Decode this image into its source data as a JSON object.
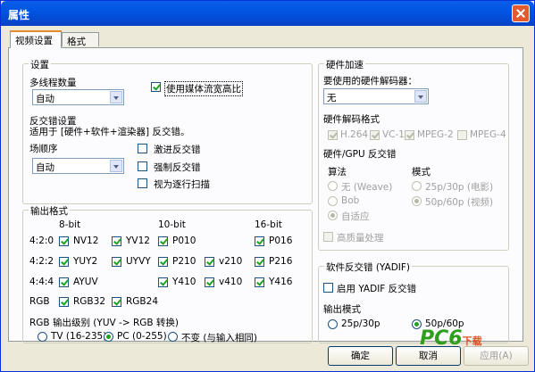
{
  "window": {
    "title": "属性"
  },
  "tabs": [
    "视频设置",
    "格式"
  ],
  "settings": {
    "title": "设置",
    "threads_label": "多线程数量",
    "threads_value": "自动",
    "use_media_ratio": "使用媒体流宽高比",
    "deinterlace_label": "反交错设置",
    "deinterlace_desc": "适用于 [硬件+软件+渲染器] 反交错。",
    "field_order_label": "场顺序",
    "field_order_value": "自动",
    "aggressive": "激进反交错",
    "force": "强制反交错",
    "progressive": "视为逐行扫描"
  },
  "output": {
    "title": "输出格式",
    "col_8bit": "8-bit",
    "col_10bit": "10-bit",
    "col_16bit": "16-bit",
    "row_420": "4:2:0",
    "row_422": "4:2:2",
    "row_444": "4:4:4",
    "row_rgb": "RGB",
    "nv12": "NV12",
    "yv12": "YV12",
    "p010": "P010",
    "p016": "P016",
    "yuy2": "YUY2",
    "uyvy": "UYVY",
    "p210": "P210",
    "v210": "v210",
    "p216": "P216",
    "ayuv": "AYUV",
    "y410": "Y410",
    "v410": "v410",
    "y416": "Y416",
    "rgb32": "RGB32",
    "rgb24": "RGB24",
    "level_label": "RGB 输出级别 (YUV -> RGB 转换)",
    "tv": "TV (16-235)",
    "pc": "PC (0-255)",
    "unchanged": "不变 (与输入相同)"
  },
  "hw": {
    "title": "硬件加速",
    "decoder_label": "要使用的硬件解码器：",
    "decoder_value": "无",
    "formats_label": "硬件解码格式",
    "h264": "H.264",
    "vc1": "VC-1",
    "mpeg2": "MPEG-2",
    "mpeg4": "MPEG-4",
    "gpu_label": "硬件/GPU 反交错",
    "algo_label": "算法",
    "mode_label": "模式",
    "weave": "无 (Weave)",
    "bob": "Bob",
    "adaptive": "自适应",
    "mode_25": "25p/30p (电影)",
    "mode_50": "50p/60p (视频)",
    "hq": "高质量处理"
  },
  "yadif": {
    "title": "软件反交错 (YADIF)",
    "enable": "启用 YADIF 反交错",
    "out_mode_label": "输出模式",
    "mode_25": "25p/30p",
    "mode_50": "50p/60p"
  },
  "buttons": {
    "ok": "确定",
    "cancel": "取消",
    "apply": "应用(A)"
  },
  "watermark": {
    "brand": "PC6",
    "sub": "下载"
  }
}
